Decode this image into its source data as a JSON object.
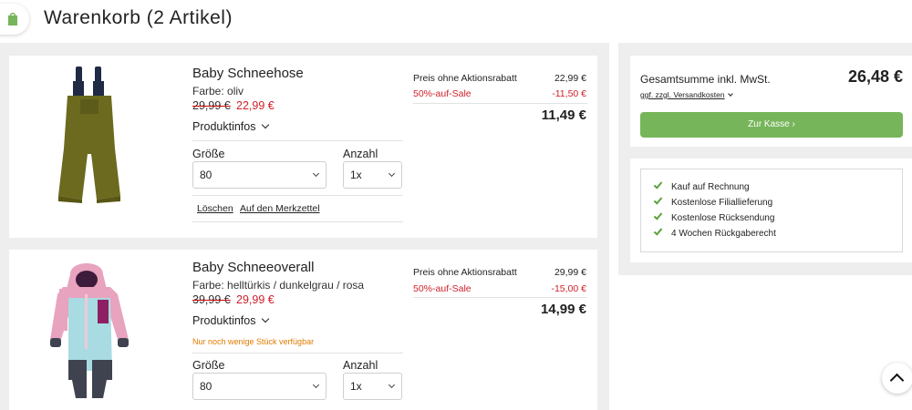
{
  "header": {
    "title": "Warenkorb (2 Artikel)",
    "logo_icon": "shopping-bag-icon",
    "brand_color": "#77b55a"
  },
  "items": [
    {
      "name": "Baby Schneehose",
      "color": "Farbe: oliv",
      "old_price": "29,99 €",
      "new_price": "22,99 €",
      "info_label": "Produktinfos",
      "size_label": "Größe",
      "size_value": "80",
      "qty_label": "Anzahl",
      "qty_value": "1x",
      "delete_label": "Löschen",
      "wishlist_label": "Auf den Merkzettel",
      "price_label": "Preis ohne Aktionsrabatt",
      "price_value": "22,99 €",
      "sale_label": "50%-auf-Sale",
      "sale_value": "-11,50 €",
      "total": "11,49 €"
    },
    {
      "name": "Baby Schneeoverall",
      "color": "Farbe: helltürkis / dunkelgrau / rosa",
      "old_price": "39,99 €",
      "new_price": "29,99 €",
      "info_label": "Produktinfos",
      "stock_note": "Nur noch wenige Stück verfügbar",
      "size_label": "Größe",
      "size_value": "80",
      "qty_label": "Anzahl",
      "qty_value": "1x",
      "price_label": "Preis ohne Aktionsrabatt",
      "price_value": "29,99 €",
      "sale_label": "50%-auf-Sale",
      "sale_value": "-15,00 €",
      "total": "14,99 €"
    }
  ],
  "summary": {
    "label": "Gesamtsumme inkl. MwSt.",
    "value": "26,48 €",
    "shipping_link": "ggf. zzgl. Versandkosten",
    "checkout_label": "Zur Kasse ›"
  },
  "benefits": [
    "Kauf auf Rechnung",
    "Kostenlose Filiallieferung",
    "Kostenlose Rücksendung",
    "4 Wochen Rückgaberecht"
  ],
  "colors": {
    "sale_red": "#d0202b",
    "stock_orange": "#e07b00",
    "check_green": "#5aa33c"
  }
}
